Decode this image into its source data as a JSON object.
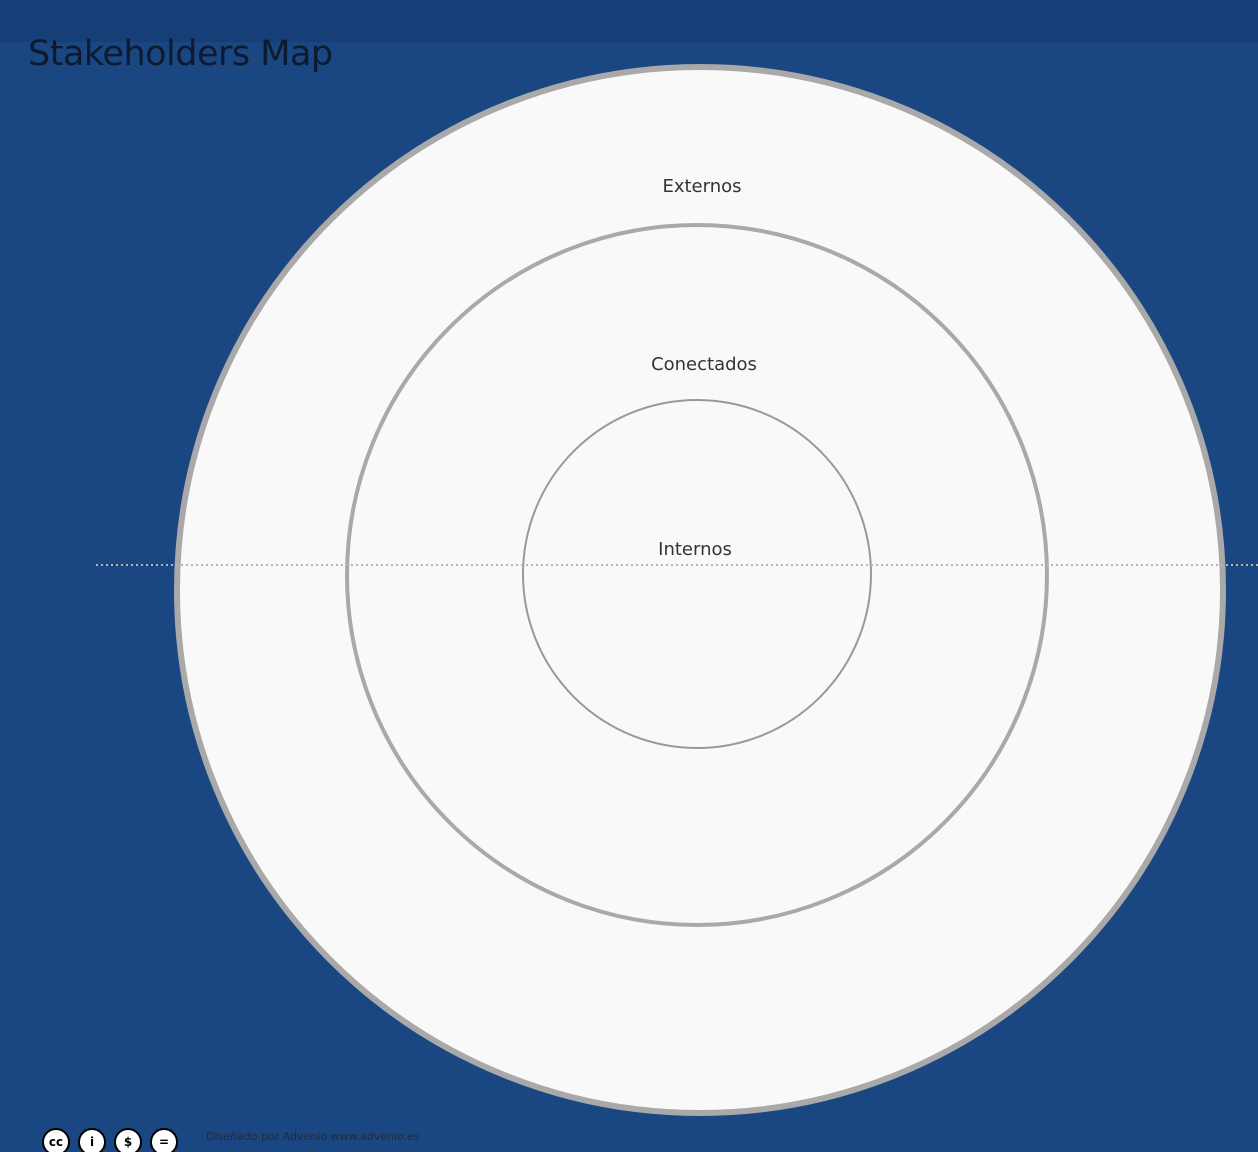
{
  "title": "Stakeholders Map",
  "rings": {
    "outer_label": "Externos",
    "middle_label": "Conectados",
    "inner_label": "Internos"
  },
  "footer": {
    "credit": "Diseñado por Advenio www.advenio.es",
    "icons": [
      "cc-icon",
      "by-icon",
      "nc-icon",
      "nd-icon"
    ],
    "icon_glyphs": [
      "cc",
      "i",
      "$",
      "="
    ]
  },
  "colors": {
    "background": "#1a4681",
    "map_fill": "#f9f9f9",
    "ring_stroke": "#a9a9a9",
    "title_text": "#0d1a30"
  }
}
